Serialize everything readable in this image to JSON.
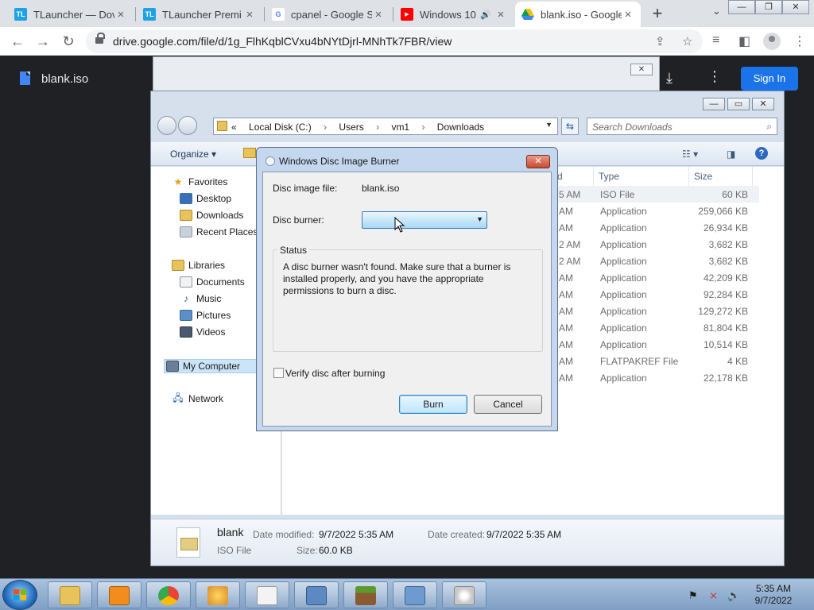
{
  "browser": {
    "tabs": [
      {
        "favicon": "TL",
        "favicon_color": "#1fa2e3",
        "title": "TLauncher — Dov",
        "active": false
      },
      {
        "favicon": "TL",
        "favicon_color": "#1fa2e3",
        "title": "TLauncher Premi",
        "active": false
      },
      {
        "favicon": "G",
        "favicon_color": "#ffffff",
        "title": "cpanel - Google S",
        "active": false
      },
      {
        "favicon": "▶",
        "favicon_color": "#ff0000",
        "title": "Windows 10",
        "active": false
      },
      {
        "favicon": "▲",
        "favicon_color": "#ffffff",
        "title": "blank.iso - Google",
        "active": true
      }
    ],
    "new_tab_icon": "+",
    "url": "drive.google.com/file/d/1g_FlhKqblCVxu4bNYtDjrl-MNhTk7FBR/view",
    "window_buttons": [
      "—",
      "❐",
      "✕"
    ]
  },
  "drive": {
    "file_name": "blank.iso",
    "sign_in_label": "Sign In"
  },
  "explorer": {
    "address_parts": [
      "«",
      "Local Disk (C:)",
      "›",
      "Users",
      "›",
      "vm1",
      "›",
      "Downloads"
    ],
    "search_placeholder": "Search Downloads",
    "organize_label": "Organize ▾",
    "nav": {
      "favorites": "Favorites",
      "desktop": "Desktop",
      "downloads": "Downloads",
      "recent": "Recent Places",
      "libraries": "Libraries",
      "documents": "Documents",
      "music": "Music",
      "pictures": "Pictures",
      "videos": "Videos",
      "computer": "My Computer",
      "network": "Network"
    },
    "columns": {
      "date": "d",
      "type": "Type",
      "size": "Size"
    },
    "rows": [
      {
        "time": "5 AM",
        "type": "ISO File",
        "size": "60 KB"
      },
      {
        "time": "AM",
        "type": "Application",
        "size": "259,066 KB"
      },
      {
        "time": "AM",
        "type": "Application",
        "size": "26,934 KB"
      },
      {
        "time": "2 AM",
        "type": "Application",
        "size": "3,682 KB"
      },
      {
        "time": "2 AM",
        "type": "Application",
        "size": "3,682 KB"
      },
      {
        "time": "AM",
        "type": "Application",
        "size": "42,209 KB"
      },
      {
        "time": "AM",
        "type": "Application",
        "size": "92,284 KB"
      },
      {
        "time": "AM",
        "type": "Application",
        "size": "129,272 KB"
      },
      {
        "time": "AM",
        "type": "Application",
        "size": "81,804 KB"
      },
      {
        "time": "AM",
        "type": "Application",
        "size": "10,514 KB"
      },
      {
        "time": "AM",
        "type": "FLATPAKREF File",
        "size": "4 KB"
      },
      {
        "time": "AM",
        "type": "Application",
        "size": "22,178 KB"
      }
    ],
    "details": {
      "name": "blank",
      "type": "ISO File",
      "modified_label": "Date modified:",
      "modified": "9/7/2022 5:35 AM",
      "created_label": "Date created:",
      "created": "9/7/2022 5:35 AM",
      "size_label": "Size:",
      "size": "60.0 KB"
    }
  },
  "dialog": {
    "title": "Windows Disc Image Burner",
    "image_file_label": "Disc image file:",
    "image_file": "blank.iso",
    "burner_label": "Disc burner:",
    "burner_value": "",
    "status_label": "Status",
    "status_text": "A disc burner wasn't found. Make sure that a burner is installed properly, and you have the appropriate permissions to burn a disc.",
    "verify_label": "Verify disc after burning",
    "verify_checked": false,
    "burn_label": "Burn",
    "cancel_label": "Cancel"
  },
  "taskbar": {
    "time": "5:35 AM",
    "date": "9/7/2022"
  }
}
